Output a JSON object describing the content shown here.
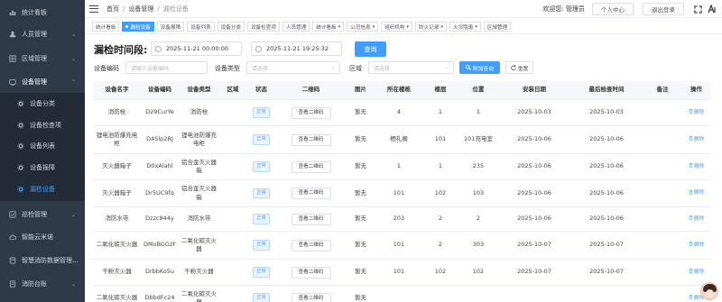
{
  "sidebar": {
    "items": [
      {
        "label": "统计看板",
        "icon": "chart-icon",
        "arrow": ""
      },
      {
        "label": "人员管理",
        "icon": "user-icon",
        "arrow": "⌄"
      },
      {
        "label": "区域管理",
        "icon": "area-icon",
        "arrow": "⌄"
      },
      {
        "label": "设备管理",
        "icon": "device-icon",
        "arrow": "⌃"
      },
      {
        "label": "设备分类",
        "icon": "gear-icon",
        "arrow": ""
      },
      {
        "label": "设备检查项",
        "icon": "gear-icon",
        "arrow": ""
      },
      {
        "label": "设备列表",
        "icon": "gear-icon",
        "arrow": ""
      },
      {
        "label": "设备报障",
        "icon": "gear-icon",
        "arrow": ""
      },
      {
        "label": "漏检设备",
        "icon": "gear-icon",
        "arrow": ""
      },
      {
        "label": "巡检管理",
        "icon": "patrol-icon",
        "arrow": "⌄"
      },
      {
        "label": "智能云米诺",
        "icon": "cloud-icon",
        "arrow": ""
      },
      {
        "label": "智慧消防数据管理...",
        "icon": "data-icon",
        "arrow": "⌄"
      },
      {
        "label": "消防台账",
        "icon": "ledger-icon",
        "arrow": "⌄"
      }
    ]
  },
  "breadcrumb": {
    "home": "首页",
    "level1": "设备管理",
    "current": "漏检设备"
  },
  "header": {
    "welcome": "欢迎您:",
    "username": "管理员",
    "profile_btn": "个人中心",
    "logout_btn": "退出登录"
  },
  "tabs": [
    {
      "label": "统计看板",
      "active": false,
      "dropdown": false
    },
    {
      "label": "漏检设备",
      "active": true,
      "dropdown": false
    },
    {
      "label": "设备报障",
      "active": false,
      "dropdown": false
    },
    {
      "label": "设备列表",
      "active": false,
      "dropdown": false
    },
    {
      "label": "设备分类",
      "active": false,
      "dropdown": false
    },
    {
      "label": "设备检查项",
      "active": false,
      "dropdown": false
    },
    {
      "label": "人员管理",
      "active": false,
      "dropdown": false
    },
    {
      "label": "统计看板",
      "active": false,
      "dropdown": true
    },
    {
      "label": "公司信息",
      "active": false,
      "dropdown": true
    },
    {
      "label": "组织机构",
      "active": false,
      "dropdown": true
    },
    {
      "label": "防火记录",
      "active": false,
      "dropdown": true
    },
    {
      "label": "火灾隐患",
      "active": false,
      "dropdown": true
    },
    {
      "label": "区域管理",
      "active": false,
      "dropdown": false
    }
  ],
  "filters": {
    "time_label": "漏检时间段:",
    "start_time": "2025-11-21 00:00:00",
    "end_time": "2025-11-21 19:25:32",
    "query_btn": "查询",
    "code_label": "设备编码",
    "code_placeholder": "请输入设备编码",
    "type_label": "设备类型",
    "type_placeholder": "请选择",
    "area_label": "区域",
    "area_placeholder": "请选择",
    "advanced_btn": "附加查询",
    "reset_btn": "重置"
  },
  "table": {
    "columns": [
      "设备名字",
      "设备编码",
      "设备类型",
      "区域",
      "状态",
      "二维码",
      "图片",
      "所在楼栋",
      "楼层",
      "位置",
      "安装日期",
      "最后检查时间",
      "备注",
      "操作"
    ],
    "qr_btn": "查看二维码",
    "delete_btn": "删除",
    "rows": [
      {
        "name": "消防栓",
        "code": "D29CurYe",
        "type": "消防栓",
        "area": "",
        "status": "正常",
        "image": "暂无",
        "building": "4",
        "floor": "1",
        "position": "1",
        "install": "2025-10-03",
        "last_check": "2025-10-03",
        "remark": ""
      },
      {
        "name": "锂电池防爆充电柜",
        "code": "D4Slp2RJ",
        "type": "锂电池防爆充电柜",
        "area": "",
        "status": "正常",
        "image": "暂无",
        "building": "栖礼阁",
        "floor": "101",
        "position": "101充电室",
        "install": "2025-10-06",
        "last_check": "2025-10-06",
        "remark": ""
      },
      {
        "name": "灭火器箱子",
        "code": "D0xAlahl",
        "type": "铝合金灭火器箱",
        "area": "",
        "status": "正常",
        "image": "暂无",
        "building": "1",
        "floor": "1",
        "position": "235",
        "install": "2025-10-06",
        "last_check": "2025-10-06",
        "remark": ""
      },
      {
        "name": "灭火器箱子",
        "code": "Dr5UC9fq",
        "type": "铝合金灭火器箱",
        "area": "",
        "status": "正常",
        "image": "暂无",
        "building": "101",
        "floor": "102",
        "position": "103",
        "install": "2025-10-06",
        "last_check": "2025-10-06",
        "remark": ""
      },
      {
        "name": "消防水带",
        "code": "Dzzc844y",
        "type": "消防水带",
        "area": "",
        "status": "正常",
        "image": "暂无",
        "building": "203",
        "floor": "2",
        "position": "2",
        "install": "2025-10-06",
        "last_check": "2025-10-06",
        "remark": ""
      },
      {
        "name": "二氧化碳灭火器",
        "code": "DMvBGGzF",
        "type": "二氧化碳灭火器",
        "area": "",
        "status": "正常",
        "image": "暂无",
        "building": "101",
        "floor": "2",
        "position": "303",
        "install": "2025-10-07",
        "last_check": "2025-10-07",
        "remark": ""
      },
      {
        "name": "干粉灭火器",
        "code": "DrbbKo5u",
        "type": "干粉灭火器",
        "area": "",
        "status": "正常",
        "image": "暂无",
        "building": "101",
        "floor": "102",
        "position": "102",
        "install": "2025-10-07",
        "last_check": "2025-10-07",
        "remark": ""
      },
      {
        "name": "二氧化碳灭火器",
        "code": "DbbdFc24",
        "type": "二氧化碳灭火器",
        "area": "",
        "status": "正常",
        "image": "暂无",
        "building": "",
        "floor": "",
        "position": "",
        "install": "",
        "last_check": "",
        "remark": ""
      }
    ]
  },
  "colors": {
    "sidebar_bg": "#2f3a48",
    "accent": "#409eff",
    "active_sub": "#409eff"
  }
}
